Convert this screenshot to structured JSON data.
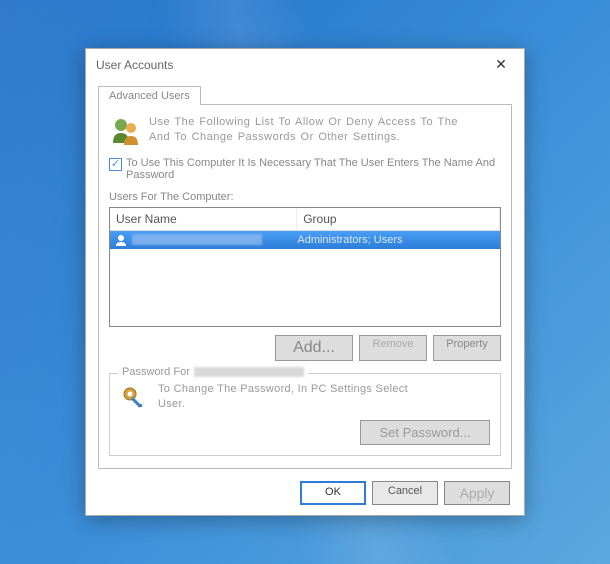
{
  "dialog": {
    "title": "User Accounts",
    "close": "✕"
  },
  "tabs": {
    "active": "Advanced Users"
  },
  "intro": {
    "line1": "Use The Following List To Allow Or Deny Access To The",
    "line2": "And To Change Passwords Or Other Settings."
  },
  "checkbox": {
    "label": "To Use This Computer It Is Necessary That The User Enters The Name And Password",
    "checked": true
  },
  "users_list": {
    "label": "Users For The Computer:",
    "columns": {
      "user": "User Name",
      "group": "Group"
    },
    "rows": [
      {
        "group": "Administrators; Users"
      }
    ]
  },
  "buttons": {
    "add": "Add...",
    "remove": "Remove",
    "property": "Property"
  },
  "password_section": {
    "legend": "Password For",
    "text_line1": "To Change The Password, In PC Settings Select",
    "text_line2": "User.",
    "set_password": "Set Password..."
  },
  "dialog_buttons": {
    "ok": "OK",
    "cancel": "Cancel",
    "apply": "Apply"
  }
}
